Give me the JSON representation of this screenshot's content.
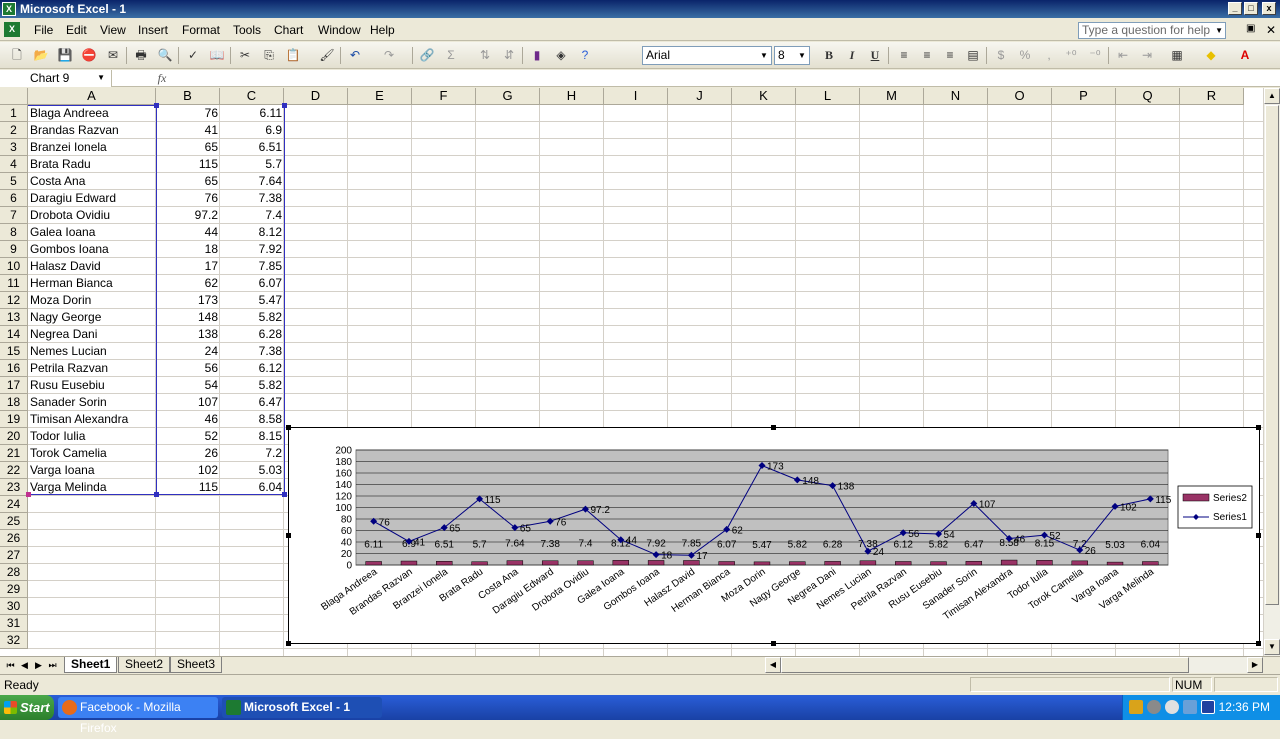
{
  "window": {
    "title": "Microsoft Excel - 1",
    "controls": [
      "_",
      "□",
      "x"
    ]
  },
  "menu": {
    "items": [
      "File",
      "Edit",
      "View",
      "Insert",
      "Format",
      "Tools",
      "Chart",
      "Window",
      "Help"
    ],
    "help_placeholder": "Type a question for help"
  },
  "toolbar": {
    "font_name": "Arial",
    "font_size": "8",
    "bold": "B",
    "italic": "I",
    "underline": "U",
    "currency": "$",
    "percent": "%"
  },
  "formula_bar": {
    "name_box": "Chart 9",
    "fx": "fx",
    "content": ""
  },
  "columns": [
    "A",
    "B",
    "C",
    "D",
    "E",
    "F",
    "G",
    "H",
    "I",
    "J",
    "K",
    "L",
    "M",
    "N",
    "O",
    "P",
    "Q",
    "R"
  ],
  "rows": [
    {
      "n": "1",
      "a": "Blaga Andreea",
      "b": "76",
      "c": "6.11"
    },
    {
      "n": "2",
      "a": "Brandas Razvan",
      "b": "41",
      "c": "6.9"
    },
    {
      "n": "3",
      "a": "Branzei Ionela",
      "b": "65",
      "c": "6.51"
    },
    {
      "n": "4",
      "a": "Brata Radu",
      "b": "115",
      "c": "5.7"
    },
    {
      "n": "5",
      "a": "Costa Ana",
      "b": "65",
      "c": "7.64"
    },
    {
      "n": "6",
      "a": "Daragiu Edward",
      "b": "76",
      "c": "7.38"
    },
    {
      "n": "7",
      "a": "Drobota Ovidiu",
      "b": "97.2",
      "c": "7.4"
    },
    {
      "n": "8",
      "a": "Galea Ioana",
      "b": "44",
      "c": "8.12"
    },
    {
      "n": "9",
      "a": "Gombos Ioana",
      "b": "18",
      "c": "7.92"
    },
    {
      "n": "10",
      "a": "Halasz David",
      "b": "17",
      "c": "7.85"
    },
    {
      "n": "11",
      "a": "Herman Bianca",
      "b": "62",
      "c": "6.07"
    },
    {
      "n": "12",
      "a": "Moza Dorin",
      "b": "173",
      "c": "5.47"
    },
    {
      "n": "13",
      "a": "Nagy George",
      "b": "148",
      "c": "5.82"
    },
    {
      "n": "14",
      "a": "Negrea Dani",
      "b": "138",
      "c": "6.28"
    },
    {
      "n": "15",
      "a": "Nemes Lucian",
      "b": "24",
      "c": "7.38"
    },
    {
      "n": "16",
      "a": "Petrila Razvan",
      "b": "56",
      "c": "6.12"
    },
    {
      "n": "17",
      "a": "Rusu Eusebiu",
      "b": "54",
      "c": "5.82"
    },
    {
      "n": "18",
      "a": "Sanader Sorin",
      "b": "107",
      "c": "6.47"
    },
    {
      "n": "19",
      "a": "Timisan Alexandra",
      "b": "46",
      "c": "8.58"
    },
    {
      "n": "20",
      "a": "Todor Iulia",
      "b": "52",
      "c": "8.15"
    },
    {
      "n": "21",
      "a": "Torok Camelia",
      "b": "26",
      "c": "7.2"
    },
    {
      "n": "22",
      "a": "Varga Ioana",
      "b": "102",
      "c": "5.03"
    },
    {
      "n": "23",
      "a": "Varga Melinda",
      "b": "115",
      "c": "6.04"
    },
    {
      "n": "24",
      "a": "",
      "b": "",
      "c": ""
    },
    {
      "n": "25",
      "a": "",
      "b": "",
      "c": ""
    },
    {
      "n": "26",
      "a": "",
      "b": "",
      "c": ""
    },
    {
      "n": "27",
      "a": "",
      "b": "",
      "c": ""
    },
    {
      "n": "28",
      "a": "",
      "b": "",
      "c": ""
    },
    {
      "n": "29",
      "a": "",
      "b": "",
      "c": ""
    },
    {
      "n": "30",
      "a": "",
      "b": "",
      "c": ""
    },
    {
      "n": "31",
      "a": "",
      "b": "",
      "c": ""
    },
    {
      "n": "32",
      "a": "",
      "b": "",
      "c": ""
    }
  ],
  "chart_data": {
    "type": "bar",
    "categories": [
      "Blaga Andreea",
      "Brandas Razvan",
      "Branzei Ionela",
      "Brata Radu",
      "Costa Ana",
      "Daragiu Edward",
      "Drobota Ovidiu",
      "Galea Ioana",
      "Gombos Ioana",
      "Halasz David",
      "Herman Bianca",
      "Moza Dorin",
      "Nagy George",
      "Negrea Dani",
      "Nemes Lucian",
      "Petrila Razvan",
      "Rusu Eusebiu",
      "Sanader Sorin",
      "Timisan Alexandra",
      "Todor Iulia",
      "Torok Camelia",
      "Varga Ioana",
      "Varga Melinda"
    ],
    "series": [
      {
        "name": "Series2",
        "kind": "bar",
        "color": "#993366",
        "values": [
          6.11,
          6.9,
          6.51,
          5.7,
          7.64,
          7.38,
          7.4,
          8.12,
          7.92,
          7.85,
          6.07,
          5.47,
          5.82,
          6.28,
          7.38,
          6.12,
          5.82,
          6.47,
          8.58,
          8.15,
          7.2,
          5.03,
          6.04
        ]
      },
      {
        "name": "Series1",
        "kind": "line",
        "color": "#000080",
        "values": [
          76,
          41,
          65,
          115,
          65,
          76,
          97.2,
          44,
          18,
          17,
          62,
          173,
          148,
          138,
          24,
          56,
          54,
          107,
          46,
          52,
          26,
          102,
          115
        ]
      }
    ],
    "y_ticks": [
      "0",
      "20",
      "40",
      "60",
      "80",
      "100",
      "120",
      "140",
      "160",
      "180",
      "200"
    ],
    "ylim": [
      0,
      200
    ],
    "plot_background": "#c0c0c0",
    "grid": true,
    "legend_position": "right"
  },
  "sheets": [
    "Sheet1",
    "Sheet2",
    "Sheet3"
  ],
  "active_sheet": "Sheet1",
  "status": {
    "ready": "Ready",
    "num": "NUM"
  },
  "taskbar": {
    "start": "Start",
    "tasks": [
      "Facebook - Mozilla Firefox",
      "Microsoft Excel - 1"
    ],
    "clock": "12:36 PM"
  }
}
